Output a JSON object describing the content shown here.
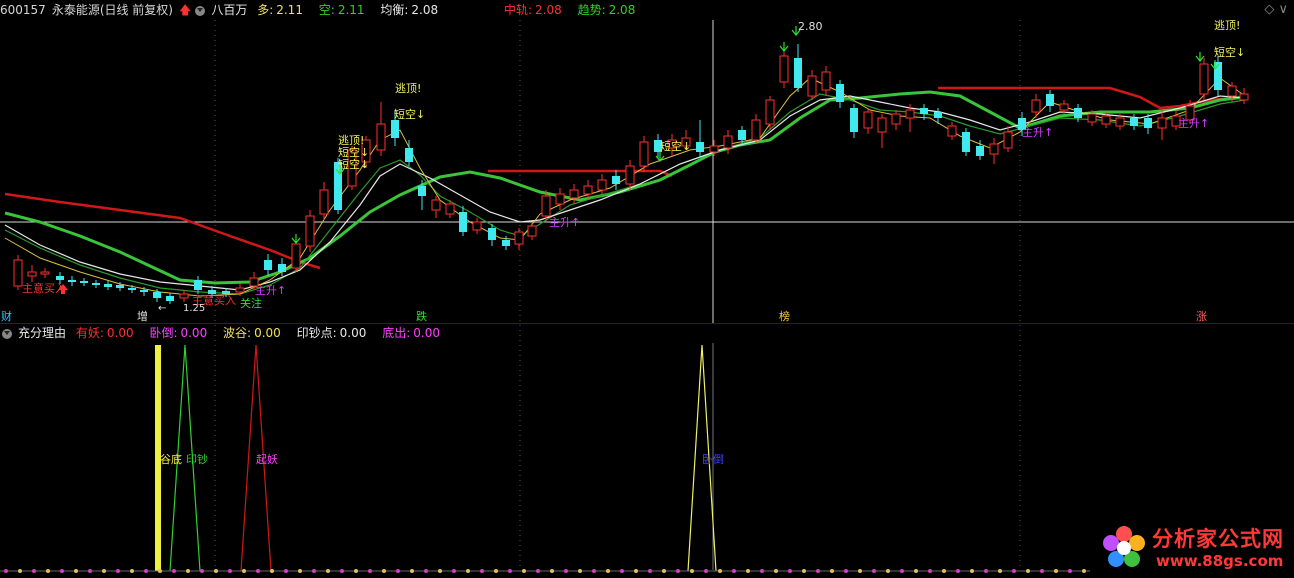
{
  "header": {
    "stock_code": "600157",
    "stock_name": "永泰能源(日线 前复权)",
    "indicator": "八百万",
    "duo_label": "多:",
    "duo_value": "2.11",
    "kong_label": "空:",
    "kong_value": "2.11",
    "junheng_label": "均衡:",
    "junheng_value": "2.08",
    "zhonggui_label": "中轨:",
    "zhonggui_value": "2.08",
    "qushi_label": "趋势:",
    "qushi_value": "2.08"
  },
  "sub_header": {
    "indicator": "充分理由",
    "youyao_label": "有妖:",
    "youyao_value": "0.00",
    "wodao_label": "卧倒:",
    "wodao_value": "0.00",
    "bogu_label": "波谷:",
    "bogu_value": "0.00",
    "yinchao_label": "印钞点:",
    "yinchao_value": "0.00",
    "dichu_label": "底出:",
    "dichu_value": "0.00"
  },
  "chart_annotations": {
    "zhuyi_mairu_1": "主意买入",
    "zhuyi_mairu_2": "主意买入",
    "low_price": "1.25",
    "guanzhu": "关注",
    "zhusheng_1": "主升↑",
    "zhusheng_2": "主升↑",
    "zhusheng_3": "主升↑",
    "zhusheng_4": "主升↑",
    "taoding_1": "逃顶!",
    "taoding_2": "逃顶!",
    "taoding_3": "逃顶!",
    "duankong_1": "短空↓",
    "duankong_2": "短空↓",
    "duankong_3": "短空↓",
    "duankong_4": "短空↓",
    "duankong_5": "短空↓",
    "high_price": "2.80",
    "marker_cai": "财",
    "marker_zeng": "增",
    "marker_die": "跌",
    "marker_bang": "榜",
    "marker_zhang": "涨"
  },
  "sub_annotations": {
    "gudi": "谷底",
    "yinchao": "印钞",
    "qiyao": "起妖",
    "wodao": "卧倒"
  },
  "watermark": {
    "title": "分析家公式网",
    "url": "www.88gs.com"
  },
  "colors": {
    "up": "#ff3030",
    "down": "#40e8f0",
    "ma_green": "#3ac43a",
    "ma_red": "#d01818",
    "ma_white": "#e8e8e8",
    "yellow": "#f0f040"
  }
}
